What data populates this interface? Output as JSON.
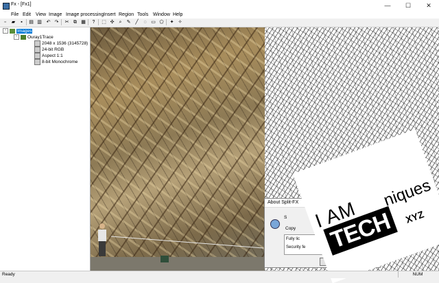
{
  "window": {
    "title": "Fx - [Fx1]",
    "minimize_glyph": "—",
    "maximize_glyph": "☐",
    "close_glyph": "✕"
  },
  "menu": [
    "File",
    "Edit",
    "View",
    "Image",
    "Image processing",
    "Insert",
    "Region",
    "Tools",
    "Window",
    "Help"
  ],
  "toolbar_icons": [
    "new-file-icon",
    "open-folder-icon",
    "save-icon",
    "print-icon",
    "print-preview-icon",
    "undo-icon",
    "redo-icon",
    "cut-icon",
    "copy-icon",
    "paste-icon",
    "help-icon",
    "select-icon",
    "move-icon",
    "zoom-icon",
    "pencil-icon",
    "line-icon",
    "lasso-icon",
    "rectangle-icon",
    "polygon-icon",
    "trace-icon",
    "magic-wand-icon"
  ],
  "toolbar_glyphs": [
    "▫",
    "▰",
    "▪",
    "▤",
    "▥",
    "↶",
    "↷",
    "✂",
    "⧉",
    "▦",
    "?",
    "⬚",
    "✣",
    "⌕",
    "✎",
    "╱",
    "◌",
    "▭",
    "⬠",
    "✦",
    "✧"
  ],
  "tree": {
    "root": {
      "toggle": "-",
      "label": "Images"
    },
    "child": {
      "toggle": "-",
      "label": "Ouray1Trace"
    },
    "properties": [
      "2048 x 1536  (3145728)",
      "24-bit RGB",
      "Aspect 1:1",
      "8-bit Monochrome"
    ]
  },
  "about": {
    "title": "About Split-FX",
    "name_fragment": "S",
    "copy_fragment": "Copy",
    "fully_fragment": "Fully lic",
    "security_fragment": "Security fe",
    "ok_label": "OK"
  },
  "watermark": {
    "line1": "I AM",
    "line2": "TECH",
    "line3": "niques",
    "line4": "XYZ"
  },
  "status": {
    "text": "Ready",
    "num": "NUM"
  },
  "colors": {
    "selection": "#0078d7",
    "tree_bg": "#ffffff",
    "chrome": "#f0f0f0"
  }
}
